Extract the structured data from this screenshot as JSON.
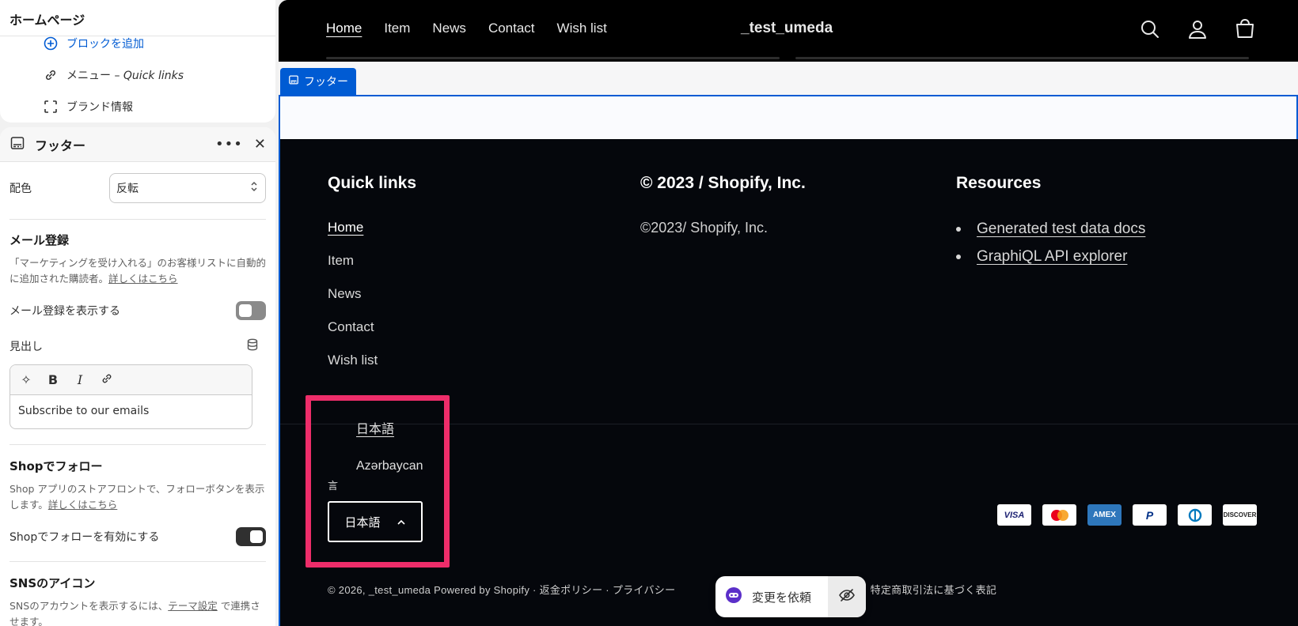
{
  "editor": {
    "page_title": "ホームページ",
    "tree_items": [
      {
        "label": "ブロックを追加",
        "icon": "plus-circle-icon"
      },
      {
        "label": "メニュー – ",
        "label_italic": "Quick links",
        "icon": "link-icon"
      },
      {
        "label": "ブランド情報",
        "icon": "dashed-frame-icon"
      }
    ],
    "section": {
      "name": "フッター",
      "color_scheme_label": "配色",
      "color_scheme_value": "反転",
      "email_signup": {
        "title": "メール登録",
        "help": "「マーケティングを受け入れる」のお客様リストに自動的に追加された購読者。",
        "help_link": "詳しくはこちら",
        "show_label": "メール登録を表示する",
        "show_enabled": false,
        "heading_label": "見出し",
        "heading_value": "Subscribe to our emails"
      },
      "shop_follow": {
        "title": "Shopでフォロー",
        "help": "Shop アプリのストアフロントで、フォローボタンを表示します。",
        "help_link": "詳しくはこちら",
        "enable_label": "Shopでフォローを有効にする",
        "enabled": true
      },
      "social": {
        "title": "SNSのアイコン",
        "help_prefix": "SNSのアカウントを表示するには、",
        "help_link": "テーマ設定",
        "help_suffix": " で連携させます。"
      }
    }
  },
  "preview": {
    "nav": [
      "Home",
      "Item",
      "News",
      "Contact",
      "Wish list"
    ],
    "brand": "_test_umeda",
    "section_tag": "フッター",
    "footer": {
      "quick_links_title": "Quick links",
      "quick_links": [
        "Home",
        "Item",
        "News",
        "Contact",
        "Wish list"
      ],
      "copyright_title": "© 2023 / Shopify, Inc.",
      "copyright_text": "©2023/ Shopify, Inc.",
      "resources_title": "Resources",
      "resources": [
        "Generated test data docs",
        "GraphiQL API explorer"
      ],
      "language_options": [
        "日本語",
        "Azərbaycan"
      ],
      "language_label": "言",
      "language_selected": "日本語",
      "payments": [
        "VISA",
        "Mastercard",
        "AMEX",
        "PayPal",
        "Diners",
        "DISCOVER"
      ],
      "bottom": "© 2026, _test_umeda Powered by Shopify  ·  返金ポリシー  ·  プライバシー",
      "bottom_right": "先情報  ·  特定商取引法に基づく表記"
    },
    "request_button": "変更を依頼"
  },
  "colors": {
    "accent": "#005bd3",
    "highlight": "#ee2d6a",
    "footer_bg": "#05070c"
  }
}
